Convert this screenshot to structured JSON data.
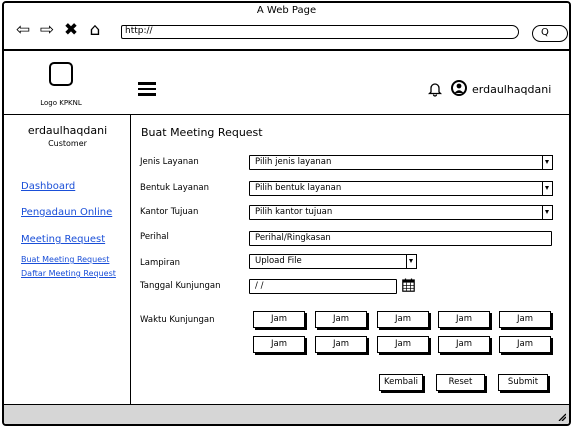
{
  "browser": {
    "window_title": "A Web Page",
    "url": "http://",
    "search_glyph": "Q"
  },
  "header": {
    "logo_label": "Logo KPKNL",
    "username": "erdaulhaqdani"
  },
  "sidebar": {
    "username": "erdaulhaqdani",
    "role": "Customer",
    "links": {
      "dashboard": "Dashboard",
      "pengaduan": "Pengadaun Online",
      "meeting": "Meeting Request",
      "buat_meeting": "Buat Meeting Request",
      "daftar_meeting": "Daftar Meeting Request"
    }
  },
  "form": {
    "title": "Buat Meeting Request",
    "jenis_layanan": {
      "label": "Jenis Layanan",
      "value": "Pilih jenis layanan"
    },
    "bentuk_layanan": {
      "label": "Bentuk Layanan",
      "value": "Pilih bentuk layanan"
    },
    "kantor_tujuan": {
      "label": "Kantor Tujuan",
      "value": "Pilih kantor tujuan"
    },
    "perihal": {
      "label": "Perihal",
      "value": "Perihal/Ringkasan"
    },
    "lampiran": {
      "label": "Lampiran",
      "value": "Upload File"
    },
    "tanggal": {
      "label": "Tanggal Kunjungan",
      "value": "/ /"
    },
    "waktu": {
      "label": "Waktu Kunjungan",
      "slots": [
        "Jam",
        "Jam",
        "Jam",
        "Jam",
        "Jam",
        "Jam",
        "Jam",
        "Jam",
        "Jam",
        "Jam"
      ]
    },
    "actions": {
      "kembali": "Kembali",
      "reset": "Reset",
      "submit": "Submit"
    }
  },
  "colors": {
    "link": "#1a4fd8",
    "status_bar": "#d6d6d6"
  }
}
